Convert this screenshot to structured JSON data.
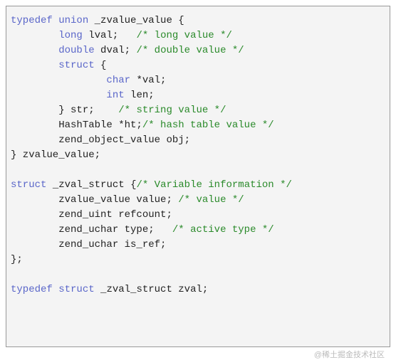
{
  "code": {
    "l1": {
      "kw1": "typedef",
      "kw2": "union",
      "name": "_zvalue_value",
      "brace": "{"
    },
    "l2": {
      "indent": "        ",
      "kw": "long",
      "var": "lval;",
      "pad": "   ",
      "cm": "/* long value */"
    },
    "l3": {
      "indent": "        ",
      "kw": "double",
      "var": "dval;",
      "pad": " ",
      "cm": "/* double value */"
    },
    "l4": {
      "indent": "        ",
      "kw": "struct",
      "brace": "{"
    },
    "l5": {
      "indent": "                ",
      "kw": "char",
      "var": "*val;"
    },
    "l6": {
      "indent": "                ",
      "kw": "int",
      "var": "len;"
    },
    "l7": {
      "indent": "        ",
      "close": "} str;",
      "pad": "    ",
      "cm": "/* string value */"
    },
    "l8": {
      "indent": "        ",
      "text": "HashTable *ht;",
      "cm": "/* hash table value */"
    },
    "l9": {
      "indent": "        ",
      "text": "zend_object_value obj;"
    },
    "l10": {
      "close": "} zvalue_value;"
    },
    "l11": {
      "blank": " "
    },
    "l12": {
      "kw": "struct",
      "name": "_zval_struct",
      "brace": "{",
      "cm": "/* Variable information */"
    },
    "l13": {
      "indent": "        ",
      "text": "zvalue_value value;",
      "pad": " ",
      "cm": "/* value */"
    },
    "l14": {
      "indent": "        ",
      "text": "zend_uint refcount;"
    },
    "l15": {
      "indent": "        ",
      "text": "zend_uchar type;",
      "pad": "   ",
      "cm": "/* active type */"
    },
    "l16": {
      "indent": "        ",
      "text": "zend_uchar is_ref;"
    },
    "l17": {
      "close": "};"
    },
    "l18": {
      "blank": " "
    },
    "l19": {
      "kw1": "typedef",
      "kw2": "struct",
      "name": "_zval_struct zval;"
    }
  },
  "watermark": "@稀土掘金技术社区"
}
